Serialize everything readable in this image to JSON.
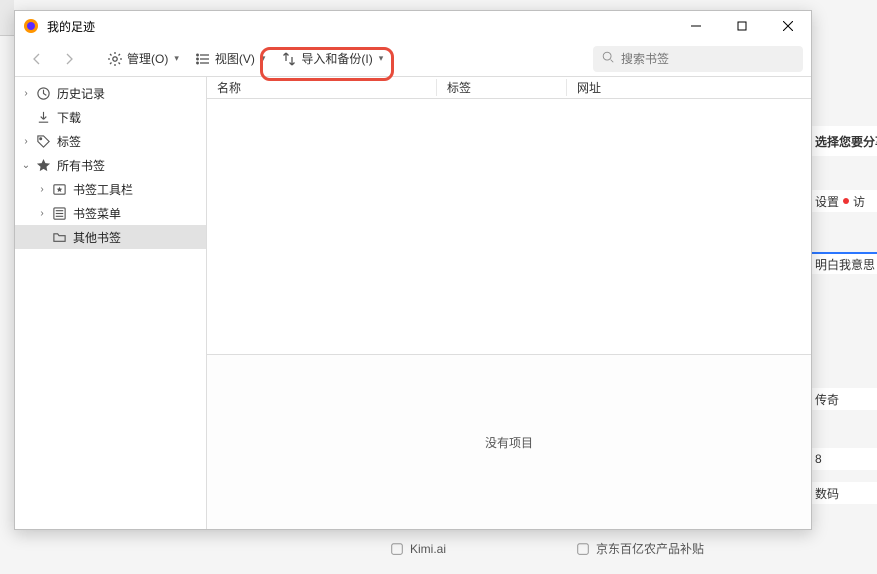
{
  "window": {
    "title": "我的足迹"
  },
  "toolbar": {
    "manage": "管理(O)",
    "view": "视图(V)",
    "import_backup": "导入和备份(I)"
  },
  "search": {
    "placeholder": "搜索书签"
  },
  "sidebar": {
    "history": "历史记录",
    "downloads": "下载",
    "tags": "标签",
    "all_bookmarks": "所有书签",
    "toolbar_bm": "书签工具栏",
    "menu_bm": "书签菜单",
    "other_bm": "其他书签"
  },
  "columns": {
    "name": "名称",
    "tag": "标签",
    "url": "网址"
  },
  "detail": {
    "empty": "没有项目"
  },
  "background": {
    "share": "选择您要分享",
    "settings": "设置",
    "visit": "访",
    "mind": "明白我意思",
    "legend": "传奇",
    "eight": "8",
    "digital": "数码",
    "kimi": "Kimi.ai",
    "jd": "京东百亿农产品补贴"
  }
}
